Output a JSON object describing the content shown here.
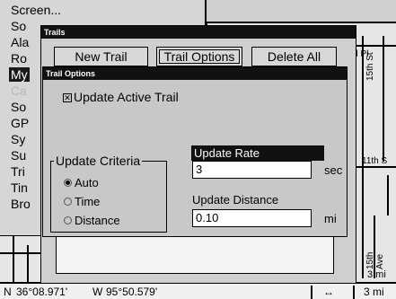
{
  "background_menu": {
    "items": [
      {
        "label": "Screen...",
        "state": "normal"
      },
      {
        "label": "So",
        "state": "normal"
      },
      {
        "label": "Ala",
        "state": "normal"
      },
      {
        "label": "Ro",
        "state": "normal"
      },
      {
        "label": "My",
        "state": "selected"
      },
      {
        "label": "Ca",
        "state": "dim"
      },
      {
        "label": "So",
        "state": "normal"
      },
      {
        "label": "GP",
        "state": "normal"
      },
      {
        "label": "Sy",
        "state": "normal"
      },
      {
        "label": "Su",
        "state": "normal"
      },
      {
        "label": "Tri",
        "state": "normal"
      },
      {
        "label": "Tin",
        "state": "normal"
      },
      {
        "label": "Bro",
        "state": "normal"
      }
    ]
  },
  "map": {
    "labels": [
      "al Pl",
      "15th St",
      "11th S",
      "15th Ave",
      "3 mi"
    ]
  },
  "status_bar": {
    "lat_dir": "N",
    "lat": "36°08.971'",
    "lon_dir": "W",
    "lon": "95°50.579'",
    "arrow": "↔",
    "scale": "3 mi"
  },
  "trails_window": {
    "title": "Trails",
    "buttons": {
      "new_trail": "New Trail",
      "trail_options": "Trail Options",
      "delete_all": "Delete All"
    }
  },
  "trail_options": {
    "title": "Trail Options",
    "update_active_trail": {
      "label": "Update Active Trail",
      "checked": true,
      "mark": "✕"
    },
    "update_criteria": {
      "label": "Update Criteria",
      "options": [
        {
          "label": "Auto",
          "selected": true
        },
        {
          "label": "Time",
          "selected": false
        },
        {
          "label": "Distance",
          "selected": false
        }
      ]
    },
    "update_rate": {
      "label": "Update Rate",
      "value": "3",
      "unit": "sec"
    },
    "update_distance": {
      "label": "Update Distance",
      "value": "0.10",
      "unit": "mi"
    }
  }
}
